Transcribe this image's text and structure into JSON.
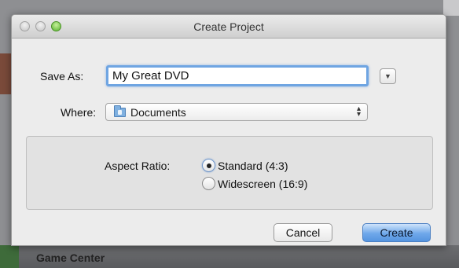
{
  "window": {
    "title": "Create Project"
  },
  "form": {
    "save_as_label": "Save As:",
    "save_as_value": "My Great DVD",
    "where_label": "Where:",
    "where_value": "Documents",
    "aspect_ratio_label": "Aspect Ratio:",
    "aspect_options": [
      {
        "label": "Standard (4:3)",
        "selected": true
      },
      {
        "label": "Widescreen (16:9)",
        "selected": false
      }
    ]
  },
  "buttons": {
    "cancel": "Cancel",
    "create": "Create"
  },
  "background": {
    "dock_item_label": "Game Center"
  },
  "icons": {
    "where": "folder-icon",
    "popup": "up-down-arrows-icon",
    "disclosure": "chevron-down-icon"
  },
  "colors": {
    "accent": "#6fa5e2",
    "primary_button": "#5594e0",
    "close_zoom_green": "#57b22e"
  }
}
